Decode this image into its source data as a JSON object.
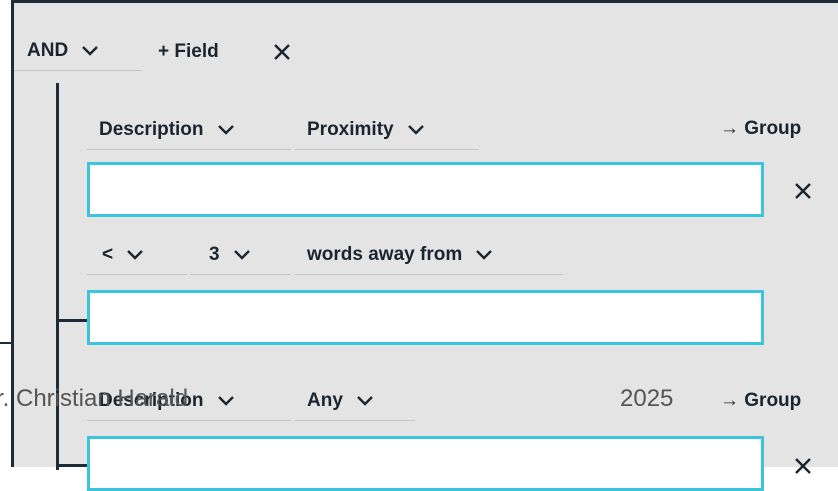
{
  "query": {
    "operator": "AND",
    "add_field_label": "+ Field",
    "remove_icon": "close-icon",
    "group_label": "→ Group"
  },
  "rows": [
    {
      "field": "Description",
      "mode": "Proximity",
      "input_value": "",
      "proximity": {
        "comparator": "<",
        "distance": "3",
        "relation": "words away from"
      },
      "second_input_value": ""
    },
    {
      "field": "Description",
      "mode": "Any",
      "input_value": ""
    }
  ],
  "watermark": {
    "author": "r. Christian Harald",
    "year": "2025"
  },
  "colors": {
    "panel_bg": "#e4e4e4",
    "input_border": "#3cc4dc",
    "tree_line": "#1e2b38"
  }
}
